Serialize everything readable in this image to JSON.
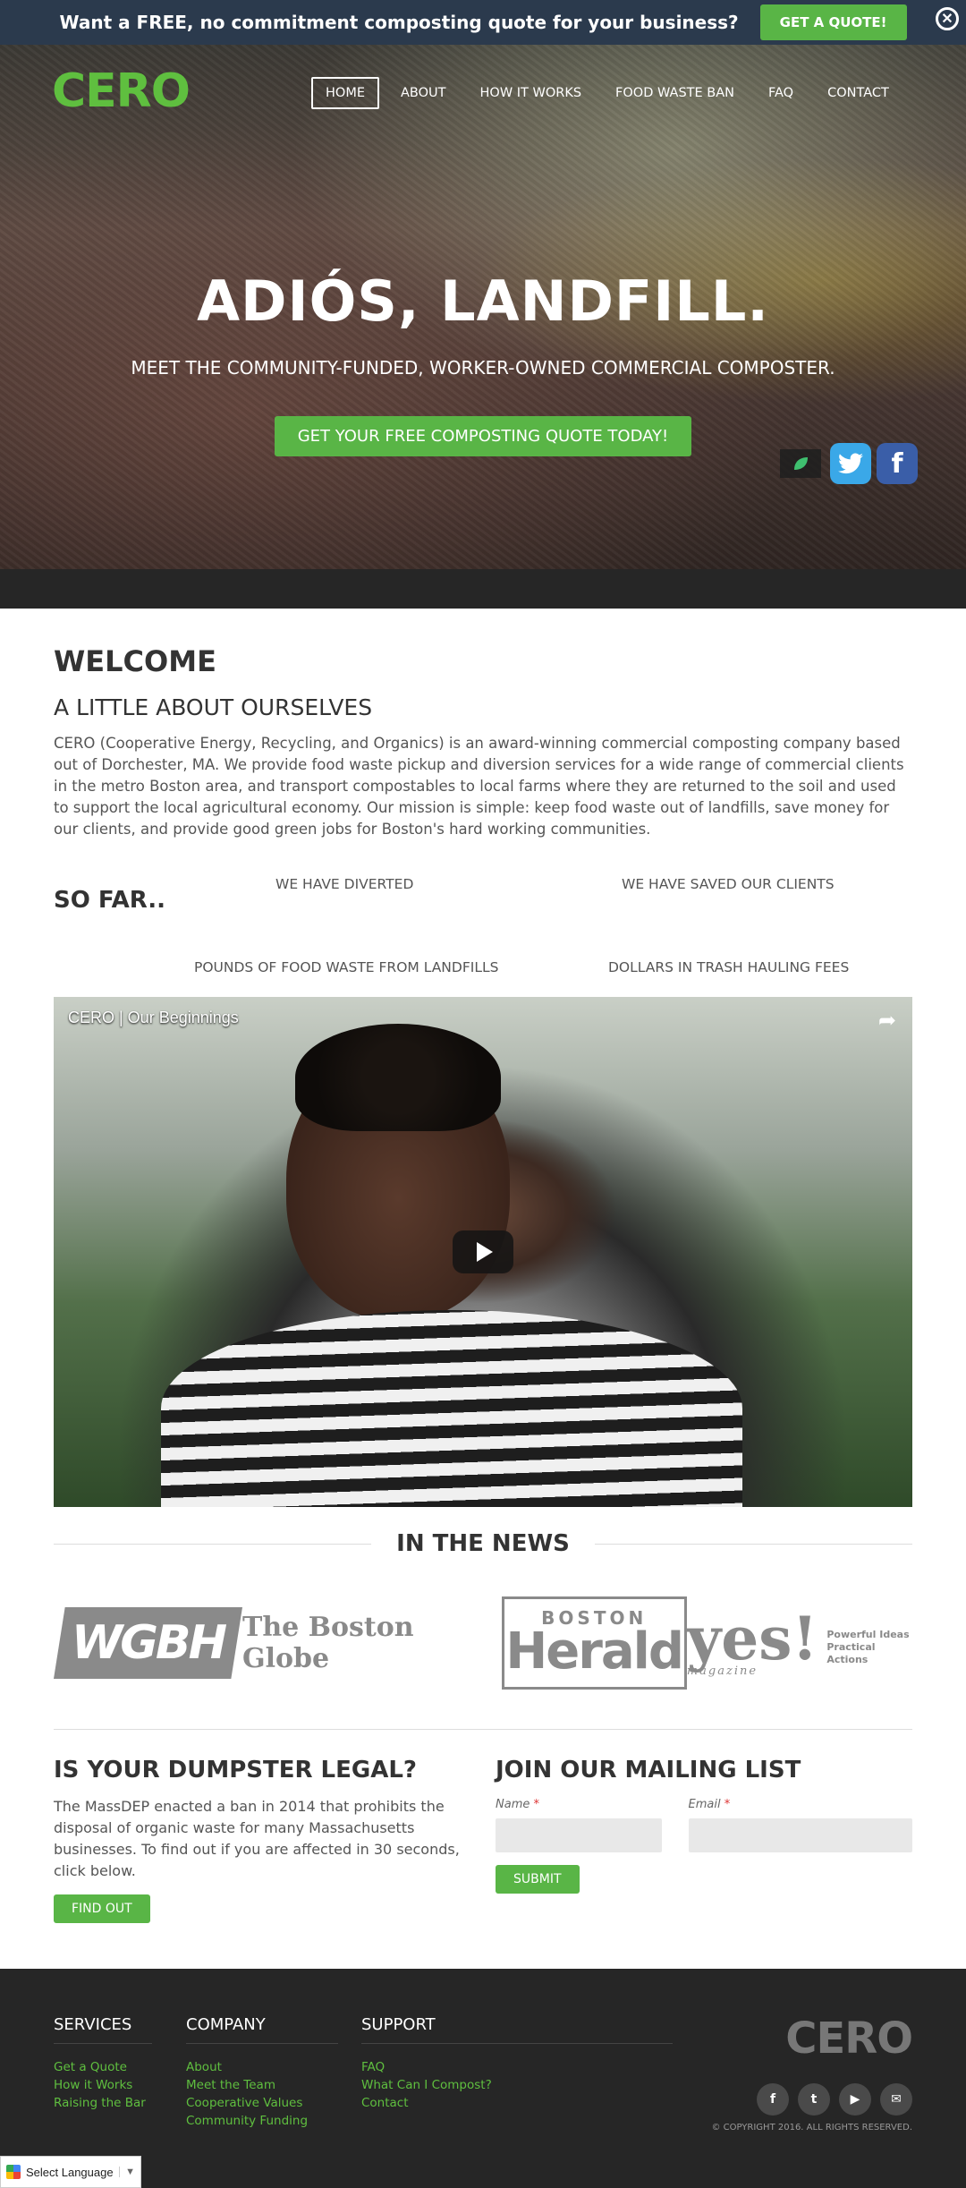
{
  "topbar": {
    "text": "Want a FREE, no commitment composting quote for your business?",
    "button": "GET A QUOTE!",
    "close_glyph": "✕"
  },
  "brand": {
    "logo": "CERO",
    "accent": "#59b546",
    "dark": "#262626",
    "topbar_bg": "#2b3a4d"
  },
  "nav": {
    "items": [
      {
        "label": "HOME"
      },
      {
        "label": "ABOUT"
      },
      {
        "label": "HOW IT WORKS"
      },
      {
        "label": "FOOD WASTE BAN"
      },
      {
        "label": "FAQ"
      },
      {
        "label": "CONTACT"
      }
    ],
    "active": "HOME"
  },
  "hero": {
    "title": "ADIÓS, LANDFILL.",
    "subtitle": "MEET THE COMMUNITY-FUNDED, WORKER-OWNED COMMERCIAL COMPOSTER.",
    "cta": "GET YOUR FREE COMPOSTING QUOTE TODAY!",
    "social": {
      "twitter_icon": "twitter-icon",
      "facebook_icon": "facebook-icon",
      "facebook_glyph": "f"
    }
  },
  "welcome": {
    "heading": "WELCOME",
    "subheading": "A LITTLE ABOUT OURSELVES",
    "text": "CERO (Cooperative Energy, Recycling, and Organics) is an award-winning commercial composting company based out of Dorchester, MA. We provide food waste pickup and diversion services for a wide range of commercial clients in the metro Boston area, and transport compostables to local farms where they are returned to the soil and used to support the local agricultural economy. Our mission is simple: keep food waste out of landfills, save money for our clients, and provide good green jobs for Boston's hard working communities."
  },
  "sofar": {
    "title": "SO FAR..",
    "stat1_top": "WE HAVE DIVERTED",
    "stat1_bottom": "POUNDS OF FOOD WASTE FROM LANDFILLS",
    "stat2_top": "WE HAVE SAVED OUR CLIENTS",
    "stat2_bottom": "DOLLARS IN TRASH HAULING FEES"
  },
  "video": {
    "title": "CERO | Our Beginnings",
    "share_glyph": "➦"
  },
  "news": {
    "heading": "IN THE NEWS",
    "logos": {
      "wgbh": "WGBH",
      "globe": "The Boston Globe",
      "herald_top": "BOSTON",
      "herald_main": "Herald",
      "yes_main": "yes!",
      "yes_sub": "magazine",
      "yes_tag1": "Powerful Ideas",
      "yes_tag2": "Practical Actions"
    }
  },
  "dumpster": {
    "heading": "IS YOUR DUMPSTER LEGAL?",
    "text": "The MassDEP enacted a ban in 2014 that prohibits the disposal of organic waste for many Massachusetts businesses. To find out if you are affected in 30 seconds, click below.",
    "button": "FIND OUT"
  },
  "mailing": {
    "heading": "JOIN OUR MAILING LIST",
    "name_label": "Name",
    "email_label": "Email",
    "required_mark": "*",
    "name_value": "",
    "email_value": "",
    "button": "SUBMIT"
  },
  "footer": {
    "services": {
      "heading": "SERVICES",
      "links": [
        "Get a Quote",
        "How it Works",
        "Raising the Bar"
      ]
    },
    "company": {
      "heading": "COMPANY",
      "links": [
        "About",
        "Meet the Team",
        "Cooperative Values",
        "Community Funding"
      ]
    },
    "support": {
      "heading": "SUPPORT",
      "links": [
        "FAQ",
        "What Can I Compost?",
        "Contact"
      ]
    },
    "logo": "CERO",
    "social_glyphs": {
      "facebook": "f",
      "twitter": "t",
      "youtube": "▶",
      "email": "✉"
    },
    "copyright": "© COPYRIGHT 2016. ALL RIGHTS RESERVED."
  },
  "language": {
    "label": "Select Language",
    "caret": "▼"
  }
}
